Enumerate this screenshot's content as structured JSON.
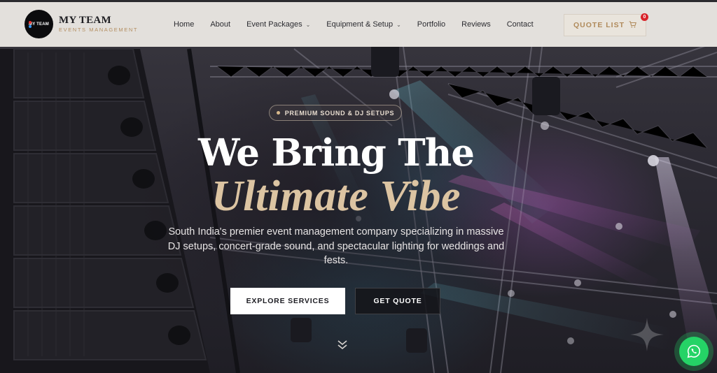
{
  "brand": {
    "title": "MY TEAM",
    "subtitle": "EVENTS MANAGEMENT",
    "badge_text": "MY TEAM",
    "accent_color": "#b08a5b"
  },
  "nav": {
    "items": [
      {
        "label": "Home",
        "has_dropdown": false
      },
      {
        "label": "About",
        "has_dropdown": false
      },
      {
        "label": "Event Packages",
        "has_dropdown": true
      },
      {
        "label": "Equipment & Setup",
        "has_dropdown": true
      },
      {
        "label": "Portfolio",
        "has_dropdown": false
      },
      {
        "label": "Reviews",
        "has_dropdown": false
      },
      {
        "label": "Contact",
        "has_dropdown": false
      }
    ],
    "quote_button_label": "QUOTE LIST",
    "cart_count": "0",
    "cart_icon": "cart-icon"
  },
  "hero": {
    "badge": "PREMIUM SOUND & DJ SETUPS",
    "headline_line1": "We Bring The",
    "headline_line2": "Ultimate Vibe",
    "description": "South India's premier event management company specializing in massive DJ setups, concert-grade sound, and spectacular lighting for weddings and fests.",
    "primary_button": "EXPLORE SERVICES",
    "secondary_button": "GET QUOTE",
    "scroll_icon": "double-chevron-down-icon",
    "headline_accent_color": "#dcc4a2"
  },
  "floating": {
    "whatsapp_icon": "whatsapp-icon",
    "whatsapp_color": "#25d366"
  }
}
